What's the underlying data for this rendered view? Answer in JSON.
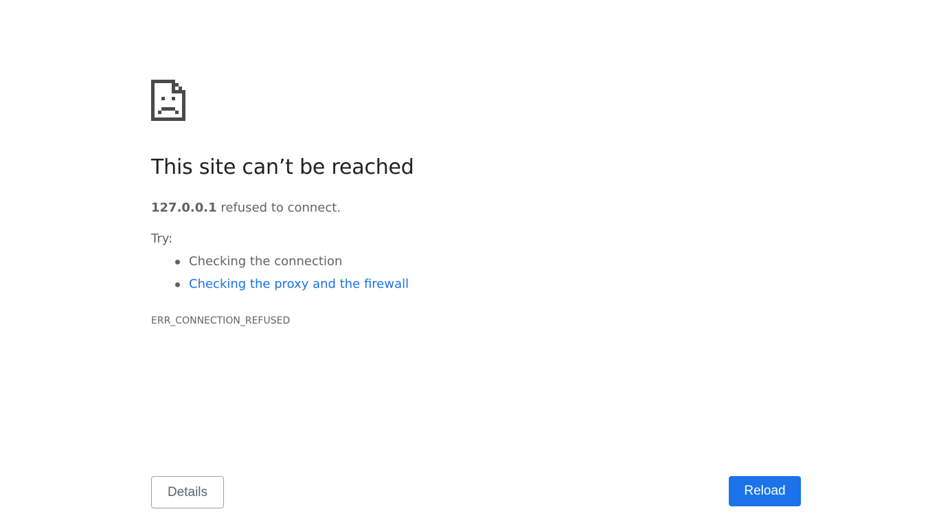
{
  "error": {
    "icon": "sad-page-icon",
    "title": "This site can’t be reached",
    "host": "127.0.0.1",
    "summary_suffix": " refused to connect.",
    "try_label": "Try:",
    "suggestions": [
      {
        "label": "Checking the connection",
        "is_link": false
      },
      {
        "label": "Checking the proxy and the firewall",
        "is_link": true
      }
    ],
    "code": "ERR_CONNECTION_REFUSED"
  },
  "buttons": {
    "details_label": "Details",
    "reload_label": "Reload"
  },
  "colors": {
    "accent": "#1a73e8",
    "text_primary": "#202124",
    "text_secondary": "#5f6368",
    "icon": "#4a4a4a"
  }
}
